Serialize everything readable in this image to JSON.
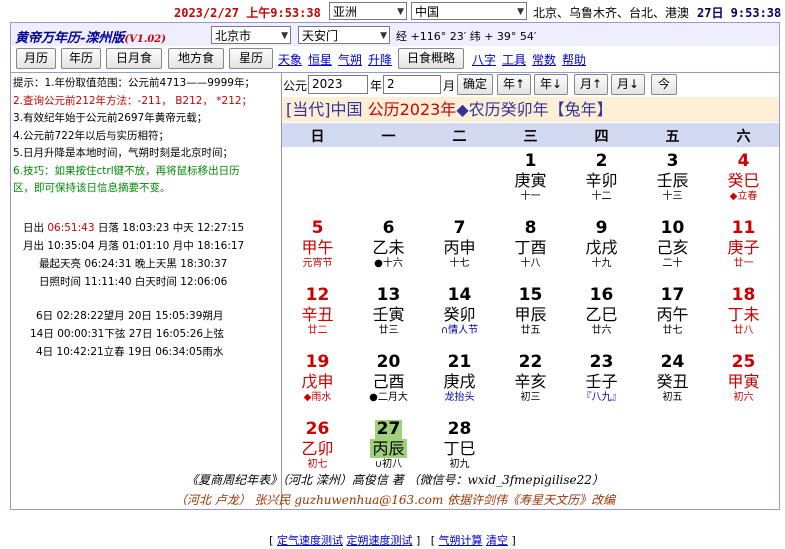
{
  "topbar": {
    "datetime": "2023/2/27 上午9:53:38",
    "region": "亚洲",
    "country": "中国",
    "cities": "北京、乌鲁木齐、台北、港澳",
    "dayclock": "27日 9:53:38"
  },
  "header": {
    "title": "黄帝万年历-滦州版",
    "version": "(V1.02)",
    "city": "北京市",
    "district": "天安门",
    "lonlat": "经 +116° 23′ 纬 + 39° 54′"
  },
  "toolbar": {
    "buttons": [
      "月历",
      "年历",
      "日月食",
      "地方食",
      "星历"
    ],
    "links1": [
      "天象",
      "恒星",
      "气朔",
      "升降"
    ],
    "button2": "日食概略",
    "links2": [
      "八字",
      "工具",
      "常数",
      "帮助"
    ]
  },
  "tips": [
    {
      "text": "提示：1.年份取值范围：公元前4713——9999年；",
      "color": "normal"
    },
    {
      "text": "2.查询公元前212年方法：-211， B212， *212；",
      "color": "red"
    },
    {
      "text": "3.有效纪年始于公元前2697年黄帝元载；",
      "color": "normal"
    },
    {
      "text": "4.公元前722年以后与实历相符；",
      "color": "normal"
    },
    {
      "text": "5.日月升降是本地时间，气朔时刻是北京时间；",
      "color": "normal"
    },
    {
      "text": "6.技巧：如果按住ctrl键不放，再将鼠标移出日历",
      "color": "green"
    },
    {
      "text": "区，即可保持该日信息摘要不变。",
      "color": "green"
    }
  ],
  "sun_moon": [
    {
      "label1": "日出",
      "val1": "06:51:43",
      "label2": "日落",
      "val2": "18:03:23",
      "label3": "中天",
      "val3": "12:27:15"
    },
    {
      "label1": "月出",
      "val1": "10:35:04",
      "label2": "月落",
      "val2": "01:01:10",
      "label3": "月中",
      "val3": "18:16:17"
    },
    {
      "label1": "最起天亮",
      "val1": "06:24:31",
      "label2": "晚上天黑",
      "val2": "18:30:37"
    },
    {
      "label1": "日照时间",
      "val1": "11:11:40",
      "label2": "白天时间",
      "val2": "12:06:06"
    }
  ],
  "terms": [
    "6日 02:28:22望月  20日 15:05:39朔月",
    "14日 00:00:31下弦  27日 16:05:26上弦",
    "4日 10:42:21立春  19日 06:34:05雨水"
  ],
  "query": {
    "era_label": "公元",
    "year": "2023",
    "year_label": "年",
    "month": "2",
    "month_label": "月",
    "confirm": "确定",
    "prev_year": "年↑",
    "next_year": "年↓",
    "prev_month": "月↑",
    "next_month": "月↓",
    "today": "今"
  },
  "banner": {
    "prefix": "[当代]中国 ",
    "year": "公历2023年",
    "rest": "◆农历癸卯年【兔年】"
  },
  "weekdays": [
    "日",
    "一",
    "二",
    "三",
    "四",
    "五",
    "六"
  ],
  "days": [
    {
      "d": "1",
      "gz": "庚寅",
      "sub": "十一",
      "col": 3,
      "row": 0
    },
    {
      "d": "2",
      "gz": "辛卯",
      "sub": "十二",
      "col": 4,
      "row": 0
    },
    {
      "d": "3",
      "gz": "壬辰",
      "sub": "十三",
      "col": 5,
      "row": 0
    },
    {
      "d": "4",
      "gz": "癸巳",
      "sub": "◆立春",
      "col": 6,
      "row": 0,
      "red": true,
      "subtype": "term"
    },
    {
      "d": "5",
      "gz": "甲午",
      "sub": "元宵节",
      "col": 0,
      "row": 1,
      "red": true,
      "subtype": "fest"
    },
    {
      "d": "6",
      "gz": "乙未",
      "sub": "●十六",
      "col": 1,
      "row": 1,
      "subtype": "moon"
    },
    {
      "d": "7",
      "gz": "丙申",
      "sub": "十七",
      "col": 2,
      "row": 1
    },
    {
      "d": "8",
      "gz": "丁酉",
      "sub": "十八",
      "col": 3,
      "row": 1
    },
    {
      "d": "9",
      "gz": "戊戌",
      "sub": "十九",
      "col": 4,
      "row": 1
    },
    {
      "d": "10",
      "gz": "己亥",
      "sub": "二十",
      "col": 5,
      "row": 1
    },
    {
      "d": "11",
      "gz": "庚子",
      "sub": "廿一",
      "col": 6,
      "row": 1,
      "red": true
    },
    {
      "d": "12",
      "gz": "辛丑",
      "sub": "廿二",
      "col": 0,
      "row": 2,
      "red": true
    },
    {
      "d": "13",
      "gz": "壬寅",
      "sub": "廿三",
      "col": 1,
      "row": 2
    },
    {
      "d": "14",
      "gz": "癸卯",
      "sub": "∩情人节",
      "col": 2,
      "row": 2,
      "subtype": "fest"
    },
    {
      "d": "15",
      "gz": "甲辰",
      "sub": "廿五",
      "col": 3,
      "row": 2
    },
    {
      "d": "16",
      "gz": "乙巳",
      "sub": "廿六",
      "col": 4,
      "row": 2
    },
    {
      "d": "17",
      "gz": "丙午",
      "sub": "廿七",
      "col": 5,
      "row": 2
    },
    {
      "d": "18",
      "gz": "丁未",
      "sub": "廿八",
      "col": 6,
      "row": 2,
      "red": true
    },
    {
      "d": "19",
      "gz": "戊申",
      "sub": "◆雨水",
      "col": 0,
      "row": 3,
      "red": true,
      "subtype": "term"
    },
    {
      "d": "20",
      "gz": "己酉",
      "sub": "●二月大",
      "col": 1,
      "row": 3,
      "subtype": "moon"
    },
    {
      "d": "21",
      "gz": "庚戌",
      "sub": "龙抬头",
      "col": 2,
      "row": 3,
      "subtype": "fest"
    },
    {
      "d": "22",
      "gz": "辛亥",
      "sub": "初三",
      "col": 3,
      "row": 3
    },
    {
      "d": "23",
      "gz": "壬子",
      "sub": "『八九』",
      "col": 4,
      "row": 3,
      "subtype": "fest"
    },
    {
      "d": "24",
      "gz": "癸丑",
      "sub": "初五",
      "col": 5,
      "row": 3
    },
    {
      "d": "25",
      "gz": "甲寅",
      "sub": "初六",
      "col": 6,
      "row": 3,
      "red": true
    },
    {
      "d": "26",
      "gz": "乙卯",
      "sub": "初七",
      "col": 0,
      "row": 4,
      "red": true
    },
    {
      "d": "27",
      "gz": "丙辰",
      "sub": "∪初八",
      "col": 1,
      "row": 4,
      "today": true
    },
    {
      "d": "28",
      "gz": "丁巳",
      "sub": "初九",
      "col": 2,
      "row": 4
    }
  ],
  "footer": {
    "line1": "《夏商周纪年表》（河北 滦州）高俊信 著  （微信号：wxid_3fmepigilise22）",
    "line2": "（河北 卢龙） 张兴民 guzhuwenhua@163.com 依据许剑伟《寿星天文历》改编"
  },
  "bottom_links": {
    "open1": "[",
    "link1": "定气速度测试",
    "link2": "定朔速度测试",
    "close1": "]",
    "open2": "[",
    "link3": "气朔计算",
    "link4": "清空",
    "close2": "]"
  },
  "colors": {
    "red": "#cc0000",
    "banner_bg": "#fcefd6",
    "weekhdr_bg": "#d2d9f1",
    "today_bg": "#9fd07a"
  }
}
